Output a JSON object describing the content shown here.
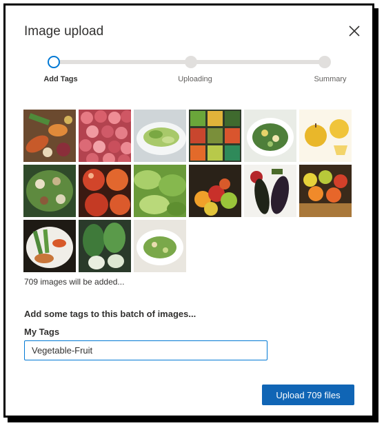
{
  "dialog": {
    "title": "Image upload",
    "close_icon": "close-icon"
  },
  "stepper": {
    "steps": [
      {
        "label": "Add Tags",
        "state": "active"
      },
      {
        "label": "Uploading",
        "state": "pending"
      },
      {
        "label": "Summary",
        "state": "pending"
      }
    ]
  },
  "images": [
    {
      "subject": "vegetables-mix"
    },
    {
      "subject": "red-apples-pile"
    },
    {
      "subject": "green-salad-bowl"
    },
    {
      "subject": "produce-market"
    },
    {
      "subject": "salad-plate"
    },
    {
      "subject": "yellow-apples"
    },
    {
      "subject": "mixed-salad"
    },
    {
      "subject": "red-apples-close"
    },
    {
      "subject": "lettuce-leaves"
    },
    {
      "subject": "fruit-bowl"
    },
    {
      "subject": "eggplants"
    },
    {
      "subject": "fruit-basket"
    },
    {
      "subject": "vegetable-plate"
    },
    {
      "subject": "bok-choy"
    },
    {
      "subject": "salad-dish"
    }
  ],
  "count_text": "709 images will be added...",
  "tags_prompt": "Add some tags to this batch of images...",
  "tags_field": {
    "label": "My Tags",
    "value": "Vegetable-Fruit"
  },
  "upload_button": {
    "label": "Upload 709 files"
  },
  "colors": {
    "accent": "#0078d4",
    "button": "#1065b5",
    "track": "#e1dfdd"
  }
}
